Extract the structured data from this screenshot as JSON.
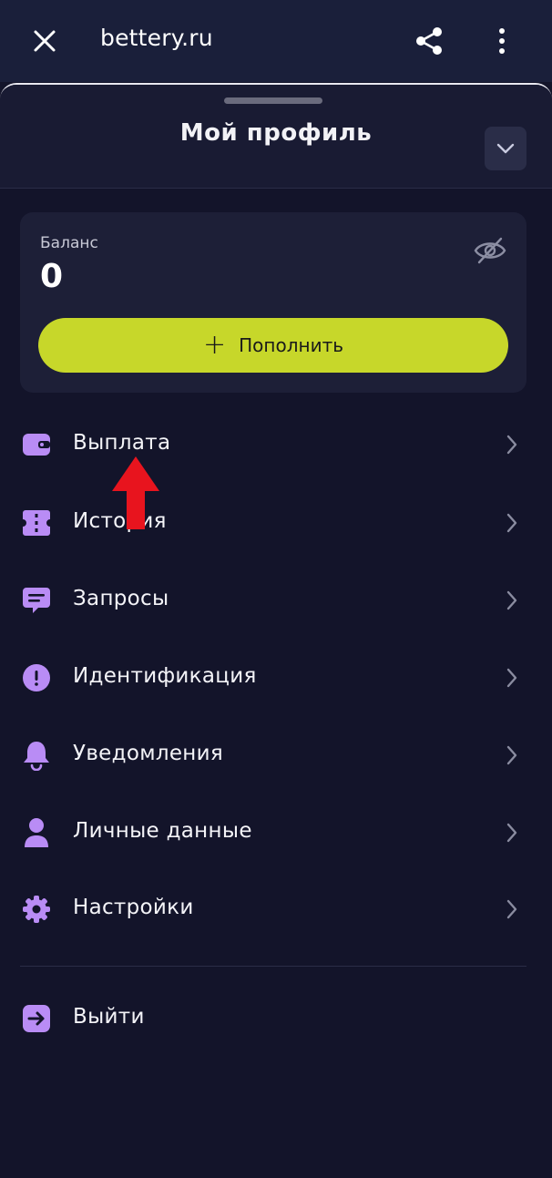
{
  "browser": {
    "url": "bettery.ru",
    "icons": {
      "close": "close-icon",
      "share": "share-icon",
      "more": "more-vertical-icon"
    }
  },
  "sheet": {
    "title": "Мой профиль",
    "collapse_icon": "chevron-down-icon"
  },
  "balance": {
    "label": "Баланс",
    "value": "0",
    "hide_icon": "eye-off-icon",
    "topup_plus": "+",
    "topup_label": "Пополнить",
    "topup_color": "#c7d72a"
  },
  "menu": {
    "accent_color": "#b98cf5",
    "items": [
      {
        "label": "Выплата",
        "icon": "wallet-icon"
      },
      {
        "label": "История",
        "icon": "ticket-icon"
      },
      {
        "label": "Запросы",
        "icon": "chat-icon"
      },
      {
        "label": "Идентификация",
        "icon": "alert-icon"
      },
      {
        "label": "Уведомления",
        "icon": "bell-icon"
      },
      {
        "label": "Личные данные",
        "icon": "user-icon"
      },
      {
        "label": "Настройки",
        "icon": "gear-icon"
      }
    ],
    "logout": {
      "label": "Выйти",
      "icon": "logout-icon"
    }
  },
  "annotation": {
    "arrow_color": "#e8141e"
  }
}
